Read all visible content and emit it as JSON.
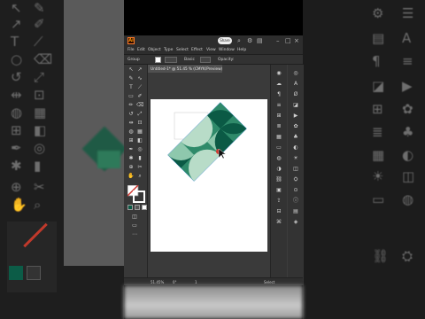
{
  "app": {
    "logo_text": "Ai",
    "share_label": "Share",
    "window_controls": [
      "minimize-icon",
      "restore-icon",
      "close-icon"
    ],
    "titlebar_icons": [
      "search-icon",
      "settings-icon",
      "layout-icon"
    ]
  },
  "menu": {
    "items": [
      "File",
      "Edit",
      "Object",
      "Type",
      "Select",
      "Effect",
      "View",
      "Window",
      "Help"
    ]
  },
  "control_bar": {
    "selection_label": "Group",
    "style_label": "Basic",
    "opacity_label": "Opacity:",
    "style_field_label": "Style:"
  },
  "document": {
    "tab_title": "Untitled-1* @ 51.45 % (CMYK/Preview)"
  },
  "status": {
    "zoom": "51.45%",
    "angle": "0°",
    "artboard_number": "1",
    "tool_name": "Select"
  },
  "colors": {
    "dark_green": "#0b5a45",
    "mid_green": "#2f8a6a",
    "light_green": "#8ec8ad",
    "pale_green": "#b8dcc8",
    "accent_red": "#d0342c",
    "app_bg": "#3a3a3a"
  }
}
